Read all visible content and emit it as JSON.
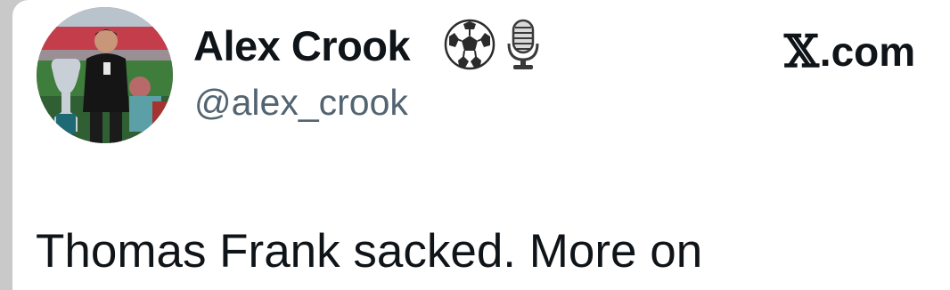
{
  "author": {
    "display_name": "Alex Crook",
    "handle": "@alex_crook",
    "name_emojis": [
      "soccer-ball-icon",
      "microphone-icon"
    ]
  },
  "source": {
    "brand_label": ".com",
    "brand_logo": "𝕏"
  },
  "tweet": {
    "text": "Thomas Frank sacked. More on"
  },
  "colors": {
    "primary_text": "#0f1419",
    "secondary_text": "#536471",
    "background": "#ffffff"
  }
}
